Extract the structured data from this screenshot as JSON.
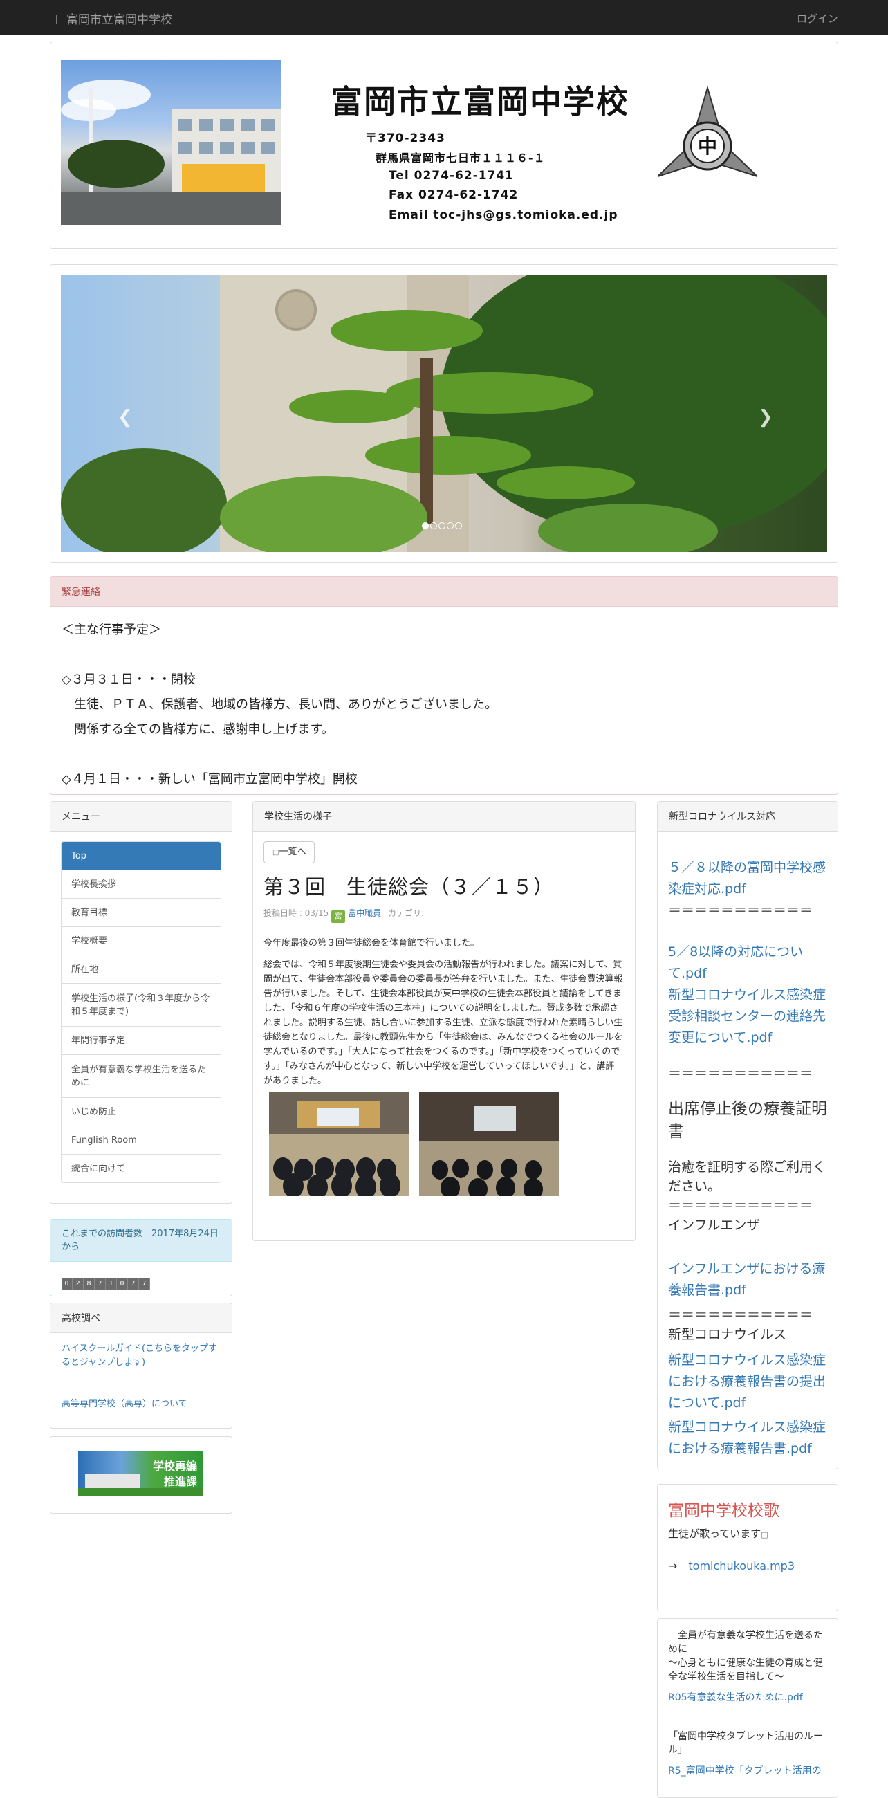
{
  "navbar": {
    "site_name": "富岡市立富岡中学校",
    "login": "ログイン"
  },
  "header": {
    "school_name": "富岡市立富岡中学校",
    "postal": "〒370-2343",
    "address": "群馬県富岡市七日市１１１６-１",
    "tel": "Tel  0274-62-1741",
    "fax": "Fax  0274-62-1742",
    "email": "Email  toc-jhs@gs.tomioka.ed.jp",
    "seal_char": "中"
  },
  "carousel": {
    "prev_icon": "chevron-left-icon",
    "next_icon": "chevron-right-icon",
    "slide_count": 5,
    "active_slide": 1
  },
  "emergency": {
    "heading": "緊急連絡",
    "lines": [
      "＜主な行事予定＞",
      "",
      "◇３月３１日・・・閉校",
      "　生徒、ＰＴＡ、保護者、地域の皆様方、長い間、ありがとうございました。",
      "　関係する全ての皆様方に、感謝申し上げます。",
      "",
      "◇４月１日・・・新しい「富岡市立富岡中学校」開校"
    ]
  },
  "menu": {
    "heading": "メニュー",
    "items": [
      {
        "label": "Top"
      },
      {
        "label": "学校長挨拶"
      },
      {
        "label": "教育目標"
      },
      {
        "label": "学校概要"
      },
      {
        "label": "所在地"
      },
      {
        "label": "学校生活の様子(令和３年度から令和５年度まで)"
      },
      {
        "label": "年間行事予定"
      },
      {
        "label": "全員が有意義な学校生活を送るために"
      },
      {
        "label": "いじめ防止"
      },
      {
        "label": "Funglish Room"
      },
      {
        "label": "統合に向けて"
      }
    ]
  },
  "counter": {
    "heading": "これまでの訪問者数　2017年8月24日から",
    "digits": [
      "0",
      "2",
      "8",
      "7",
      "1",
      "0",
      "7",
      "7"
    ]
  },
  "highschool": {
    "heading": "高校調べ",
    "link1": "ハイスクールガイド(こちらをタップするとジャンプします)",
    "link2": "高等専門学校（高専）について"
  },
  "banner": {
    "line1": "学校再編",
    "line2": "推進課"
  },
  "life": {
    "heading": "学校生活の様子",
    "back_button": "一覧へ",
    "title": "第３回　生徒総会（３／１５）",
    "posted": "投稿日時 : 03/15",
    "author_icon_char": "富",
    "author": "富中職員",
    "category": "カテゴリ:",
    "paragraph1": "今年度最後の第３回生徒総会を体育館で行いました。",
    "paragraph2": "総会では、令和５年度後期生徒会や委員会の活動報告が行われました。議案に対して、質問が出て、生徒会本部役員や委員会の委員長が答弁を行いました。また、生徒会費決算報告が行いました。そして、生徒会本部役員が東中学校の生徒会本部役員と議論をしてきました、「令和６年度の学校生活の三本柱」についての説明をしました。賛成多数で承認されました。説明する生徒、話し合いに参加する生徒、立派な態度で行われた素晴らしい生徒総会となりました。最後に教頭先生から「生徒総会は、みんなでつくる社会のルールを学んでいるのです。」「大人になって社会をつくるのです。」「新中学校をつくっていくのです。」「みなさんが中心となって、新しい中学校を運営していってほしいです。」と、講評がありました。"
  },
  "corona": {
    "heading": "新型コロナウイルス対応",
    "link1": "５／８以降の富岡中学校感染症対応.pdf",
    "sep": "＝＝＝＝＝＝＝＝＝＝＝",
    "link2": "5／8以降の対応について.pdf",
    "link3": "新型コロナウイルス感染症受診相談センターの連絡先変更について.pdf",
    "cert_heading": "出席停止後の療養証明書",
    "cert_text": "治癒を証明する際ご利用ください。",
    "flu_label": "インフルエンザ",
    "flu_link": "インフルエンザにおける療養報告書.pdf",
    "covid_label": "新型コロナウイルス",
    "covid_link1": "新型コロナウイルス感染症における療養報告書の提出について.pdf",
    "covid_link2": "新型コロナウイルス感染症における療養報告書.pdf"
  },
  "song": {
    "title": "富岡中学校校歌",
    "text": "生徒が歌っています",
    "arrow": "→",
    "link": "tomichukouka.mp3"
  },
  "rules": {
    "text1": "　全員が有意義な学校生活を送るために\n〜心身ともに健康な生徒の育成と健全な学校生活を目指して〜",
    "link1": "R05有意義な生活のために.pdf",
    "text2": "「富岡中学校タブレット活用のルール」",
    "link2": "R5_富岡中学校「タブレット活用の"
  }
}
